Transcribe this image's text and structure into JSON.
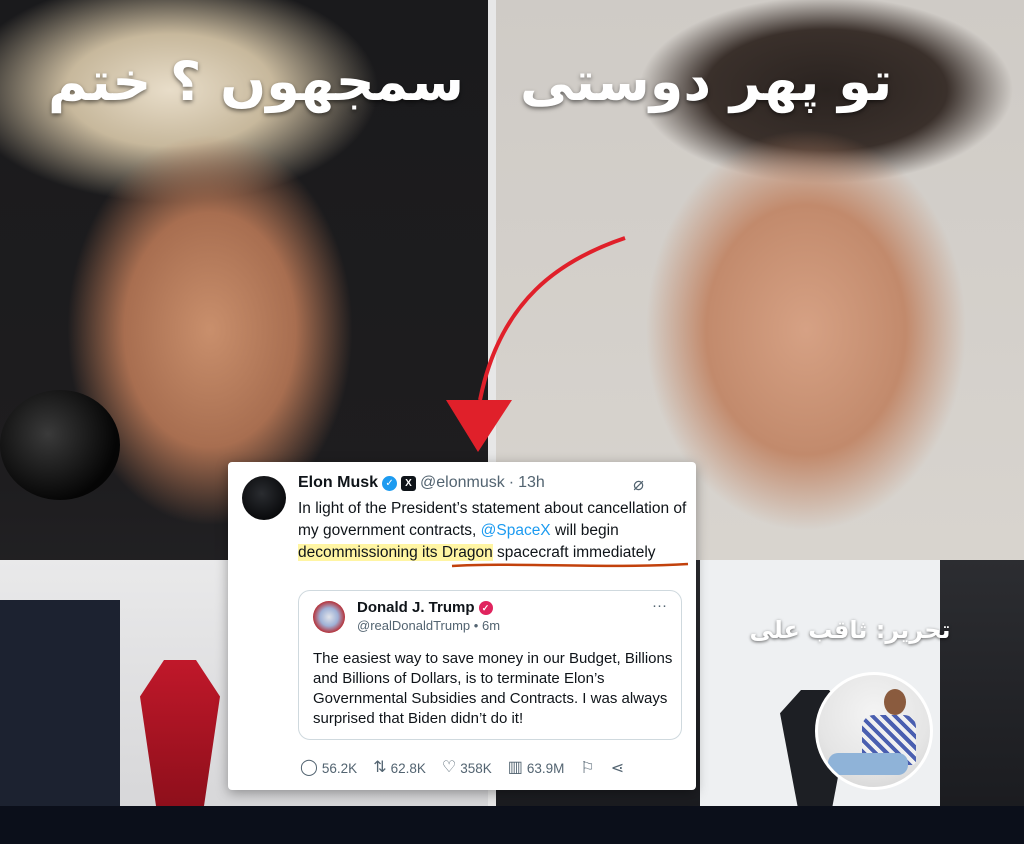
{
  "headline": {
    "left": "سمجھوں ؟ ختم",
    "right": "تو پھر دوستی"
  },
  "credit": {
    "label": "تحریر: ثاقب علی"
  },
  "tweet": {
    "author_name": "Elon Musk",
    "handle": "@elonmusk",
    "time": "13h",
    "body_part1": "In light of the President’s statement about cancellation of my government contracts, ",
    "mention": "@SpaceX",
    "body_part2": " will begin ",
    "highlight": "decommissioning its Dragon",
    "body_part3": " spacecraft immediately",
    "quote": {
      "author_name": "Donald J. Trump",
      "handle": "@realDonaldTrump",
      "time": "6m",
      "body": "The easiest way to save money in our Budget, Billions and Billions of Dollars, is to terminate Elon’s Governmental Subsidies and Contracts. I was always surprised that Biden didn’t do it!"
    },
    "stats": {
      "replies": "56.2K",
      "reposts": "62.8K",
      "likes": "358K",
      "views": "63.9M"
    }
  },
  "colors": {
    "arrow": "#e0202a",
    "highlight": "#fff5a3",
    "underline": "#c2410c",
    "link": "#1d9bf0"
  }
}
